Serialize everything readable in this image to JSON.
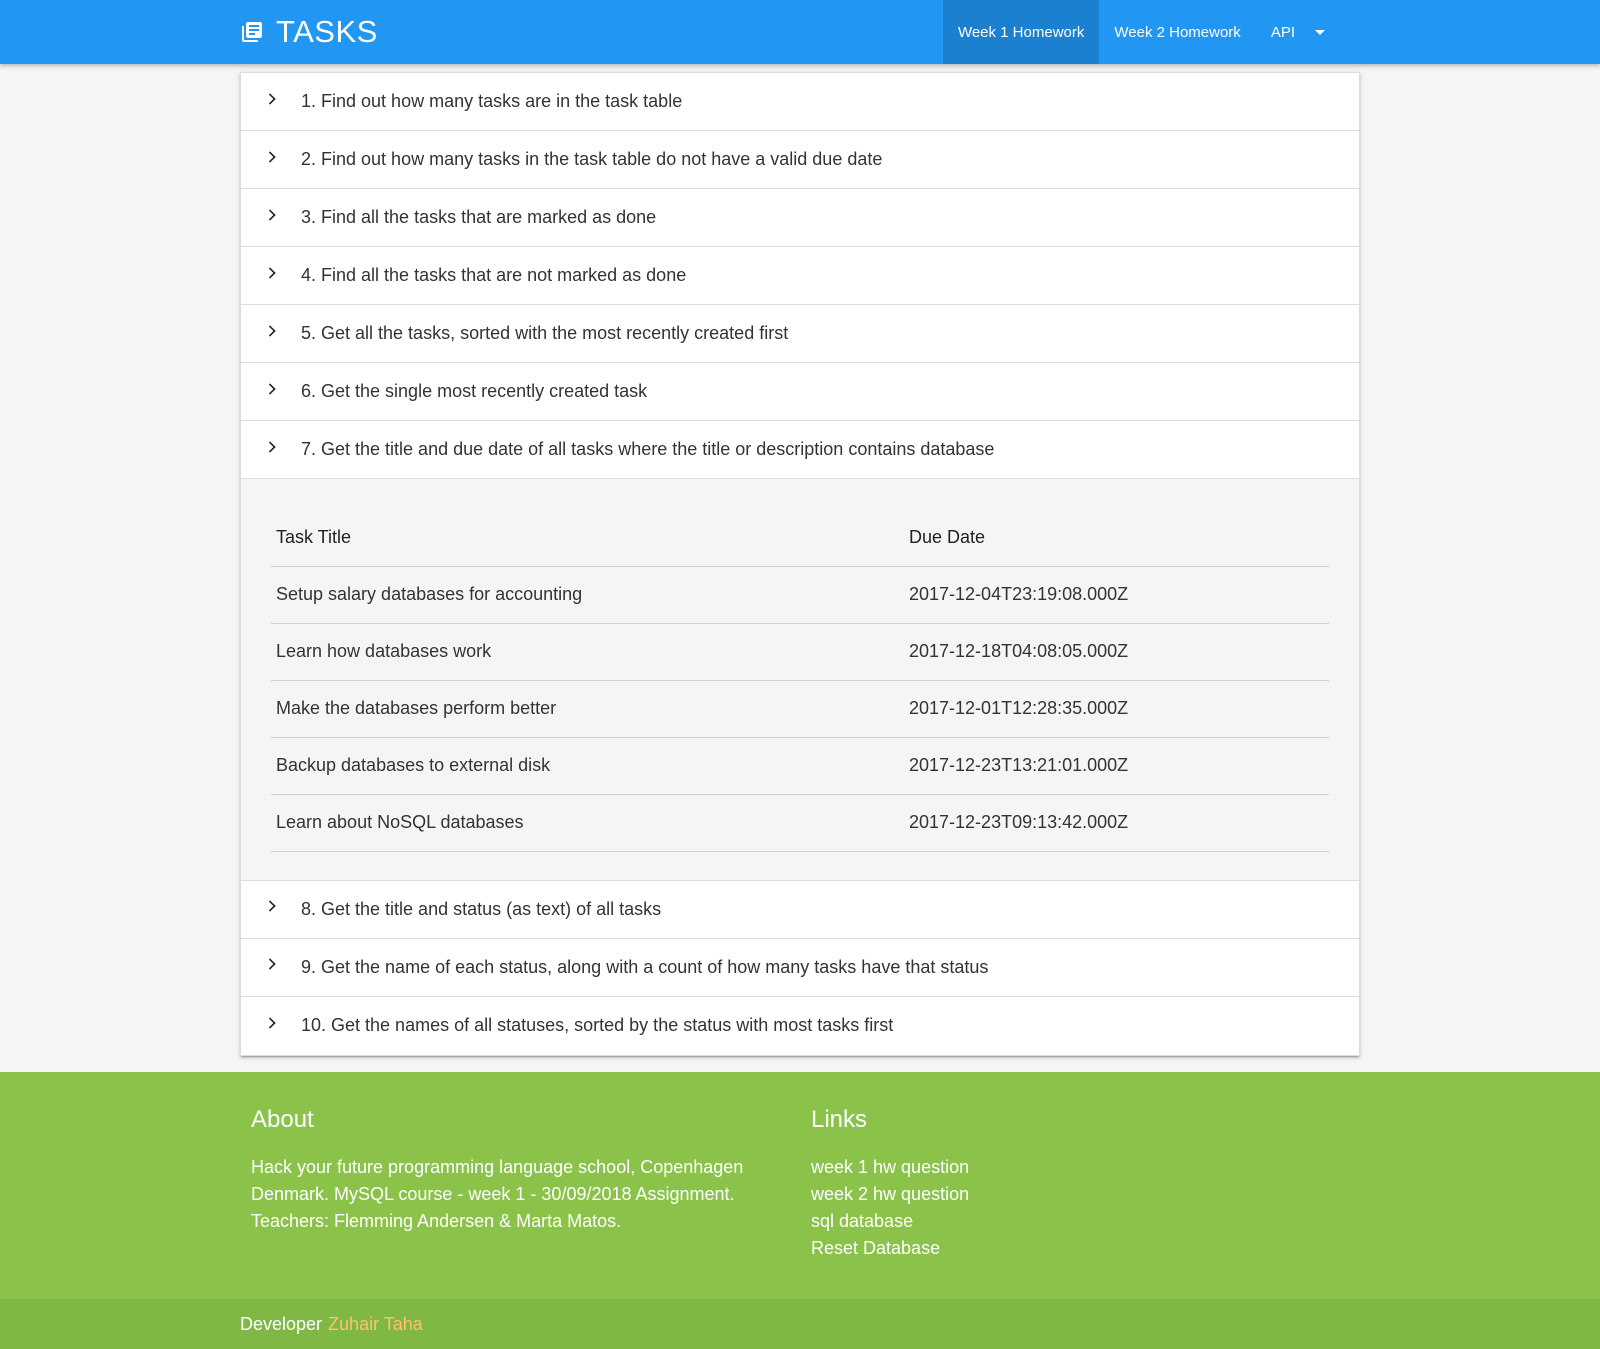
{
  "nav": {
    "brand": "TASKS",
    "brand_icon": "library-books-icon",
    "items": [
      {
        "label": "Week 1 Homework",
        "active": true
      },
      {
        "label": "Week 2 Homework",
        "active": false
      },
      {
        "label": "API",
        "active": false
      }
    ],
    "accent": "#2196f3"
  },
  "questions": [
    {
      "label": "1. Find out how many tasks are in the task table"
    },
    {
      "label": "2. Find out how many tasks in the task table do not have a valid due date"
    },
    {
      "label": "3. Find all the tasks that are marked as done"
    },
    {
      "label": "4. Find all the tasks that are not marked as done"
    },
    {
      "label": "5. Get all the tasks, sorted with the most recently created first"
    },
    {
      "label": "6. Get the single most recently created task"
    },
    {
      "label": "7. Get the title and due date of all tasks where the title or description contains database"
    },
    {
      "label": "8. Get the title and status (as text) of all tasks"
    },
    {
      "label": "9. Get the name of each status, along with a count of how many tasks have that status"
    },
    {
      "label": "10. Get the names of all statuses, sorted by the status with most tasks first"
    }
  ],
  "result": {
    "headers": [
      "Task Title",
      "Due Date"
    ],
    "rows": [
      [
        "Setup salary databases for accounting",
        "2017-12-04T23:19:08.000Z"
      ],
      [
        "Learn how databases work",
        "2017-12-18T04:08:05.000Z"
      ],
      [
        "Make the databases perform better",
        "2017-12-01T12:28:35.000Z"
      ],
      [
        "Backup databases to external disk",
        "2017-12-23T13:21:01.000Z"
      ],
      [
        "Learn about NoSQL databases",
        "2017-12-23T09:13:42.000Z"
      ]
    ]
  },
  "footer": {
    "about_title": "About",
    "about_text": "Hack your future programming language school, Copenhagen Denmark. MySQL course - week 1 - 30/09/2018 Assignment. Teachers: Flemming Andersen & Marta Matos.",
    "links_title": "Links",
    "links": [
      "week 1 hw question",
      "week 2 hw question",
      "sql database",
      "Reset Database"
    ],
    "developer_label": "Developer",
    "developer_name": "Zuhair Taha",
    "bg": "#8bc34a",
    "name_color": "#ffc36b"
  }
}
